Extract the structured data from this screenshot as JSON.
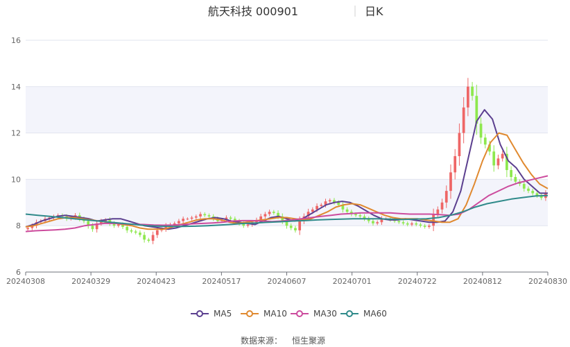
{
  "chart_data": {
    "type": "candlestick",
    "title": "航天科技 000901",
    "period_label": "日K",
    "source_label": "数据来源：",
    "source_name": "恒生聚源",
    "y_ticks": [
      "6",
      "8",
      "10",
      "12",
      "14",
      "16"
    ],
    "ylim": [
      6,
      16
    ],
    "x_tick_labels": [
      "20240308",
      "20240329",
      "20240423",
      "20240517",
      "20240607",
      "20240701",
      "20240722",
      "20240812",
      "20240830"
    ],
    "bands": [
      [
        8,
        10
      ],
      [
        12,
        14
      ]
    ],
    "colors": {
      "up": "#ee6666",
      "down": "#8ee84e",
      "band": "#f3f4fb",
      "grid": "#e2e5ef"
    },
    "legend": [
      {
        "name": "MA5",
        "color": "#5b3f8f"
      },
      {
        "name": "MA10",
        "color": "#e0892f"
      },
      {
        "name": "MA30",
        "color": "#cc4b9d"
      },
      {
        "name": "MA60",
        "color": "#2f8a8a"
      }
    ],
    "close": [
      7.9,
      8.0,
      8.15,
      8.2,
      8.3,
      8.35,
      8.4,
      8.45,
      8.4,
      8.3,
      8.35,
      8.45,
      8.3,
      8.2,
      8.0,
      7.85,
      8.1,
      8.2,
      8.25,
      8.1,
      8.0,
      8.05,
      7.95,
      7.8,
      7.75,
      7.7,
      7.6,
      7.4,
      7.35,
      7.6,
      7.8,
      7.85,
      8.0,
      8.05,
      8.1,
      8.2,
      8.3,
      8.3,
      8.35,
      8.4,
      8.5,
      8.45,
      8.4,
      8.3,
      8.2,
      8.25,
      8.35,
      8.3,
      8.2,
      8.1,
      8.0,
      8.05,
      8.15,
      8.25,
      8.4,
      8.5,
      8.6,
      8.55,
      8.4,
      8.2,
      8.0,
      7.9,
      7.8,
      8.2,
      8.4,
      8.6,
      8.7,
      8.85,
      8.9,
      9.05,
      9.1,
      9.0,
      8.9,
      8.7,
      8.6,
      8.5,
      8.45,
      8.4,
      8.3,
      8.2,
      8.1,
      8.15,
      8.3,
      8.3,
      8.25,
      8.2,
      8.15,
      8.1,
      8.05,
      8.1,
      8.05,
      8.0,
      7.95,
      8.0,
      8.5,
      8.7,
      9.0,
      9.5,
      10.3,
      11.0,
      12.0,
      13.1,
      14.0,
      13.6,
      12.4,
      11.8,
      11.5,
      11.2,
      10.6,
      10.9,
      11.1,
      10.4,
      10.1,
      9.9,
      9.8,
      9.6,
      9.5,
      9.4,
      9.3,
      9.2,
      9.4
    ],
    "series": [
      {
        "name": "MA5",
        "values": [
          7.95,
          8.05,
          8.2,
          8.3,
          8.4,
          8.45,
          8.4,
          8.35,
          8.3,
          8.2,
          8.25,
          8.3,
          8.3,
          8.2,
          8.1,
          8.0,
          7.95,
          7.9,
          7.85,
          7.9,
          8.0,
          8.1,
          8.2,
          8.3,
          8.35,
          8.3,
          8.2,
          8.15,
          8.1,
          8.05,
          8.2,
          8.35,
          8.4,
          8.3,
          8.2,
          8.3,
          8.5,
          8.7,
          8.9,
          9.0,
          9.05,
          9.0,
          8.85,
          8.65,
          8.45,
          8.3,
          8.25,
          8.25,
          8.3,
          8.25,
          8.2,
          8.15,
          8.15,
          8.2,
          8.6,
          9.5,
          11.0,
          12.5,
          13.0,
          12.6,
          11.5,
          10.8,
          10.5,
          10.0,
          9.7,
          9.4,
          9.4
        ]
      },
      {
        "name": "MA10",
        "values": [
          7.95,
          8.0,
          8.1,
          8.2,
          8.3,
          8.35,
          8.35,
          8.3,
          8.25,
          8.2,
          8.15,
          8.1,
          8.05,
          8.0,
          7.9,
          7.85,
          7.85,
          7.85,
          7.95,
          8.05,
          8.15,
          8.25,
          8.3,
          8.3,
          8.25,
          8.15,
          8.1,
          8.15,
          8.2,
          8.25,
          8.3,
          8.35,
          8.35,
          8.3,
          8.25,
          8.3,
          8.45,
          8.6,
          8.8,
          8.9,
          8.95,
          8.9,
          8.75,
          8.6,
          8.45,
          8.35,
          8.3,
          8.3,
          8.3,
          8.25,
          8.2,
          8.15,
          8.15,
          8.3,
          8.9,
          9.8,
          10.8,
          11.6,
          12.0,
          11.9,
          11.3,
          10.7,
          10.2,
          9.8,
          9.6
        ]
      },
      {
        "name": "MA30",
        "values": [
          7.75,
          7.78,
          7.8,
          7.82,
          7.85,
          7.9,
          8.0,
          8.05,
          8.1,
          8.1,
          8.08,
          8.06,
          8.05,
          8.03,
          8.02,
          8.03,
          8.05,
          8.08,
          8.1,
          8.12,
          8.15,
          8.2,
          8.22,
          8.22,
          8.2,
          8.18,
          8.2,
          8.25,
          8.3,
          8.35,
          8.4,
          8.45,
          8.5,
          8.52,
          8.55,
          8.55,
          8.55,
          8.55,
          8.52,
          8.5,
          8.5,
          8.5,
          8.48,
          8.45,
          8.5,
          8.7,
          9.0,
          9.3,
          9.5,
          9.7,
          9.85,
          9.95,
          10.05,
          10.15
        ]
      },
      {
        "name": "MA60",
        "values": [
          8.5,
          8.45,
          8.4,
          8.35,
          8.3,
          8.25,
          8.2,
          8.15,
          8.1,
          8.05,
          8.0,
          7.98,
          7.97,
          7.97,
          7.98,
          8.0,
          8.03,
          8.06,
          8.1,
          8.12,
          8.15,
          8.17,
          8.2,
          8.22,
          8.25,
          8.27,
          8.28,
          8.3,
          8.3,
          8.3,
          8.28,
          8.27,
          8.28,
          8.3,
          8.35,
          8.45,
          8.6,
          8.8,
          8.95,
          9.05,
          9.15,
          9.22,
          9.28,
          9.3
        ]
      }
    ]
  }
}
